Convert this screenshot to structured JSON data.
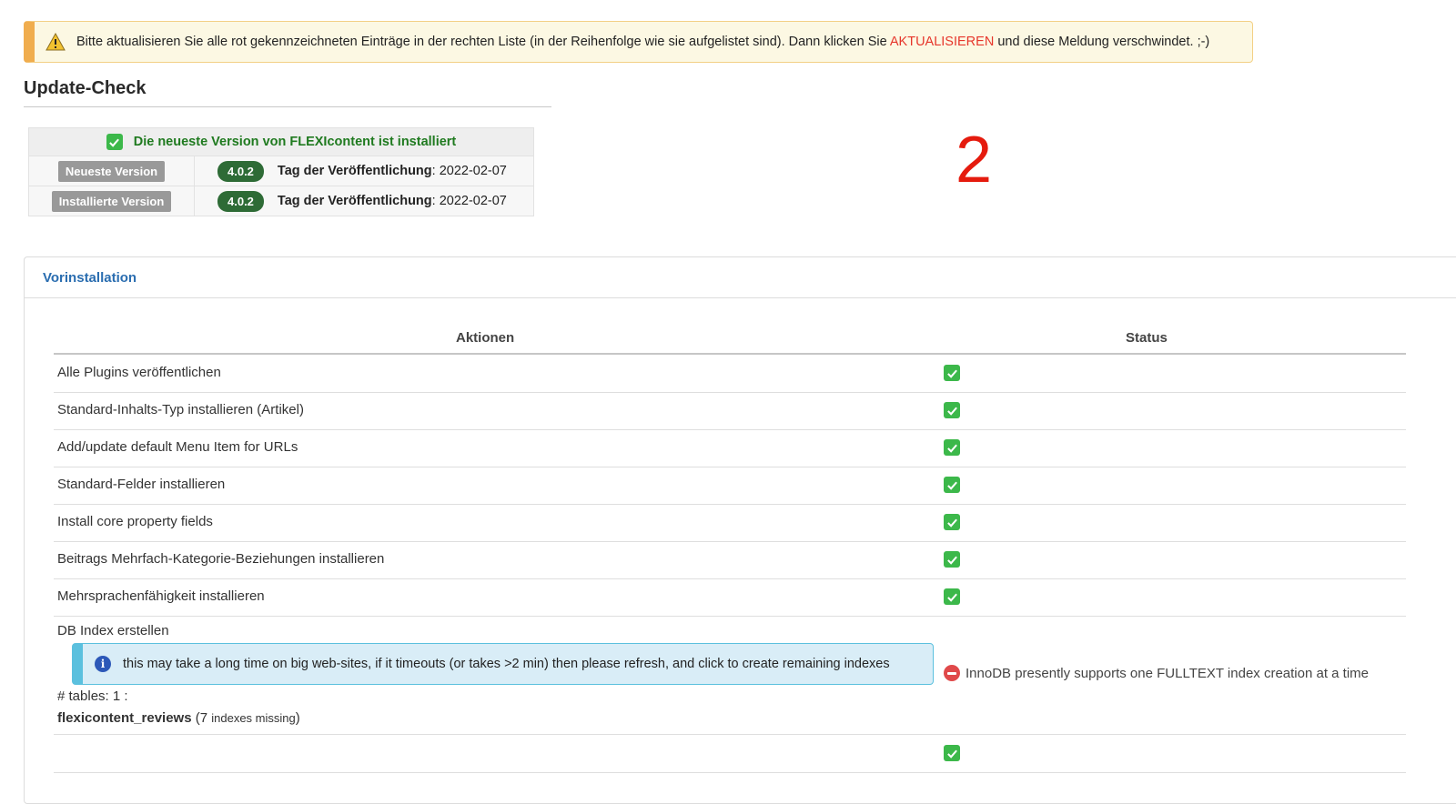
{
  "warning": {
    "text_before": "Bitte aktualisieren Sie alle rot gekennzeichneten Einträge in der rechten Liste (in der Reihenfolge wie sie aufgelistet sind). Dann klicken Sie ",
    "highlight": "AKTUALISIEREN",
    "text_after": " und diese Meldung verschwindet. ;-)"
  },
  "update_check": {
    "title": "Update-Check",
    "status": "Die neueste Version von FLEXIcontent ist installiert",
    "release_label": "Tag der Veröffentlichung",
    "rows": [
      {
        "label": "Neueste Version",
        "version": "4.0.2",
        "date": "2022-02-07"
      },
      {
        "label": "Installierte Version",
        "version": "4.0.2",
        "date": "2022-02-07"
      }
    ]
  },
  "annotation_number": "2",
  "preinstall": {
    "title": "Vorinstallation",
    "col_actions": "Aktionen",
    "col_status": "Status",
    "rows": [
      {
        "label": "Alle Plugins veröffentlichen"
      },
      {
        "label": "Standard-Inhalts-Typ installieren (Artikel)"
      },
      {
        "label": "Add/update default Menu Item for URLs"
      },
      {
        "label": "Standard-Felder installieren"
      },
      {
        "label": "Install core property fields"
      },
      {
        "label": "Beitrags Mehrfach-Kategorie-Beziehungen installieren"
      },
      {
        "label": "Mehrsprachenfähigkeit installieren"
      }
    ],
    "db_index": {
      "label": "DB Index erstellen",
      "info": "this may take a long time on big web-sites, if it timeouts (or takes >2 min) then please refresh, and click to create remaining indexes",
      "tables": "# tables: 1 :",
      "table_name": "flexicontent_reviews",
      "missing_open": " (7 ",
      "missing_text": "indexes missing",
      "missing_close": ")",
      "status": "InnoDB presently supports one FULLTEXT index creation at a time"
    }
  },
  "colors": {
    "warning_accent": "#f0ad4e",
    "highlight": "#e6362b",
    "success": "#3cb84a",
    "version_badge": "#2e6b36",
    "info_accent": "#5bc0de",
    "panel_title": "#2a6db0",
    "annotation": "#e51b0e"
  }
}
